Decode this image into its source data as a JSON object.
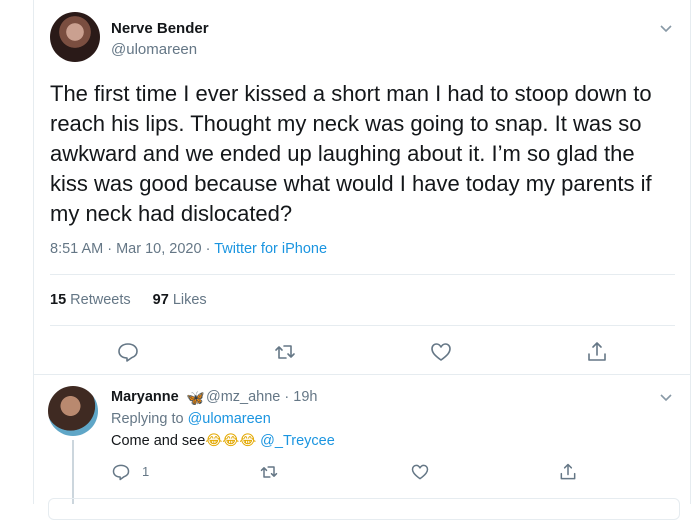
{
  "tweet": {
    "author_name": "Nerve Bender",
    "author_handle": "@ulomareen",
    "text": "The first time I ever kissed a short man I had to stoop down to reach his lips. Thought my neck was going to snap. It was so awkward and we ended up laughing about it. I’m so glad the kiss was good because what would I have today my parents if my neck had dislocated?",
    "time": "8:51 AM",
    "date": "Mar 10, 2020",
    "source": "Twitter for iPhone",
    "retweets_count": "15",
    "retweets_label": "Retweets",
    "likes_count": "97",
    "likes_label": "Likes"
  },
  "reply": {
    "author_name": "Maryanne",
    "name_emoji": "🦋",
    "author_handle": "@mz_ahne",
    "age": "19h",
    "replying_label": "Replying to",
    "replying_to": "@ulomareen",
    "text": "Come and see",
    "emojis": "😂😂😂",
    "mention": "@_Treycee",
    "reply_count": "1"
  },
  "colors": {
    "accent": "#1b95e0",
    "secondary_text": "#657786",
    "divider": "#e6ecf0"
  },
  "icons": [
    "chevron-down-icon",
    "reply-icon",
    "retweet-icon",
    "like-icon",
    "share-icon",
    "butterfly-emoji",
    "laughing-emoji"
  ]
}
